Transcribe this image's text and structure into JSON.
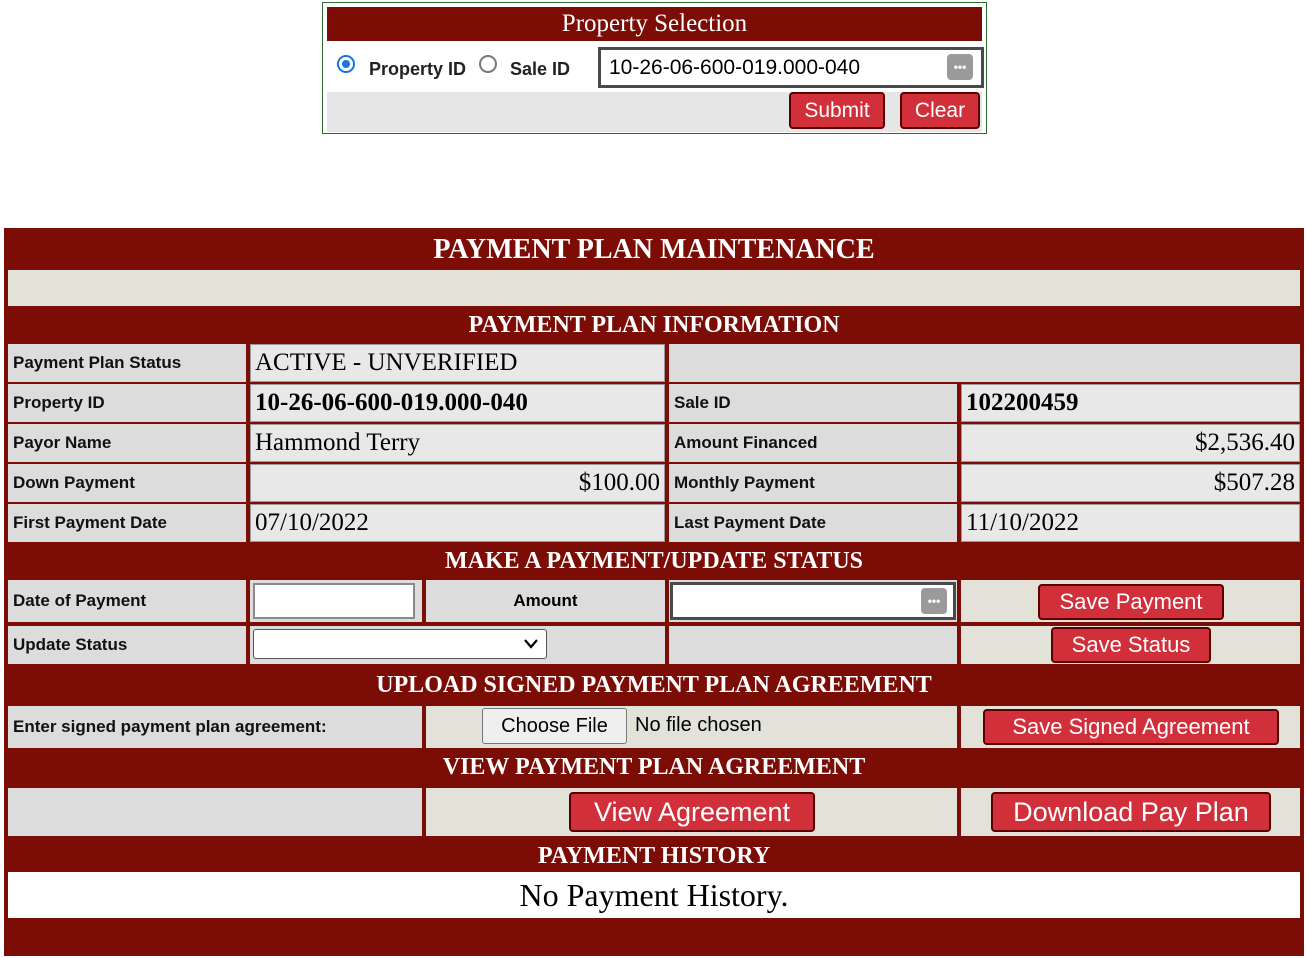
{
  "selection": {
    "title": "Property Selection",
    "radio_property_id": "Property ID",
    "radio_sale_id": "Sale ID",
    "selected_mode": "Property ID",
    "search_value": "10-26-06-600-019.000-040",
    "submit_label": "Submit",
    "clear_label": "Clear"
  },
  "main": {
    "title": "PAYMENT PLAN MAINTENANCE",
    "info_header": "PAYMENT PLAN INFORMATION",
    "info": {
      "status_label": "Payment Plan Status",
      "status_value": "ACTIVE - UNVERIFIED",
      "property_id_label": "Property ID",
      "property_id_value": "10-26-06-600-019.000-040",
      "sale_id_label": "Sale ID",
      "sale_id_value": "102200459",
      "payor_label": "Payor Name",
      "payor_value": "Hammond Terry",
      "amount_financed_label": "Amount Financed",
      "amount_financed_value": "$2,536.40",
      "down_payment_label": "Down Payment",
      "down_payment_value": "$100.00",
      "monthly_payment_label": "Monthly Payment",
      "monthly_payment_value": "$507.28",
      "first_payment_label": "First Payment Date",
      "first_payment_value": "07/10/2022",
      "last_payment_label": "Last Payment Date",
      "last_payment_value": "11/10/2022"
    },
    "payment_header": "MAKE A PAYMENT/UPDATE STATUS",
    "payment": {
      "date_label": "Date of Payment",
      "date_value": "",
      "amount_label": "Amount",
      "amount_value": "",
      "save_payment_label": "Save Payment",
      "update_status_label": "Update Status",
      "update_status_value": "",
      "save_status_label": "Save Status"
    },
    "upload_header": "UPLOAD SIGNED PAYMENT PLAN AGREEMENT",
    "upload": {
      "label": "Enter signed payment plan agreement:",
      "choose_file_label": "Choose File",
      "no_file_text": "No file chosen",
      "save_agreement_label": "Save Signed Agreement"
    },
    "view_header": "VIEW PAYMENT PLAN AGREEMENT",
    "view": {
      "view_agreement_label": "View Agreement",
      "download_label": "Download Pay Plan"
    },
    "history_header": "PAYMENT HISTORY",
    "history_text": "No Payment History."
  },
  "icons": {
    "password_manager": "password-manager-icon",
    "dropdown": "chevron-down-icon"
  },
  "colors": {
    "header_maroon": "#7b0c06",
    "button_red": "#d12f3a",
    "cell_gray": "#dcdcdc",
    "radio_blue": "#1a73e8"
  }
}
